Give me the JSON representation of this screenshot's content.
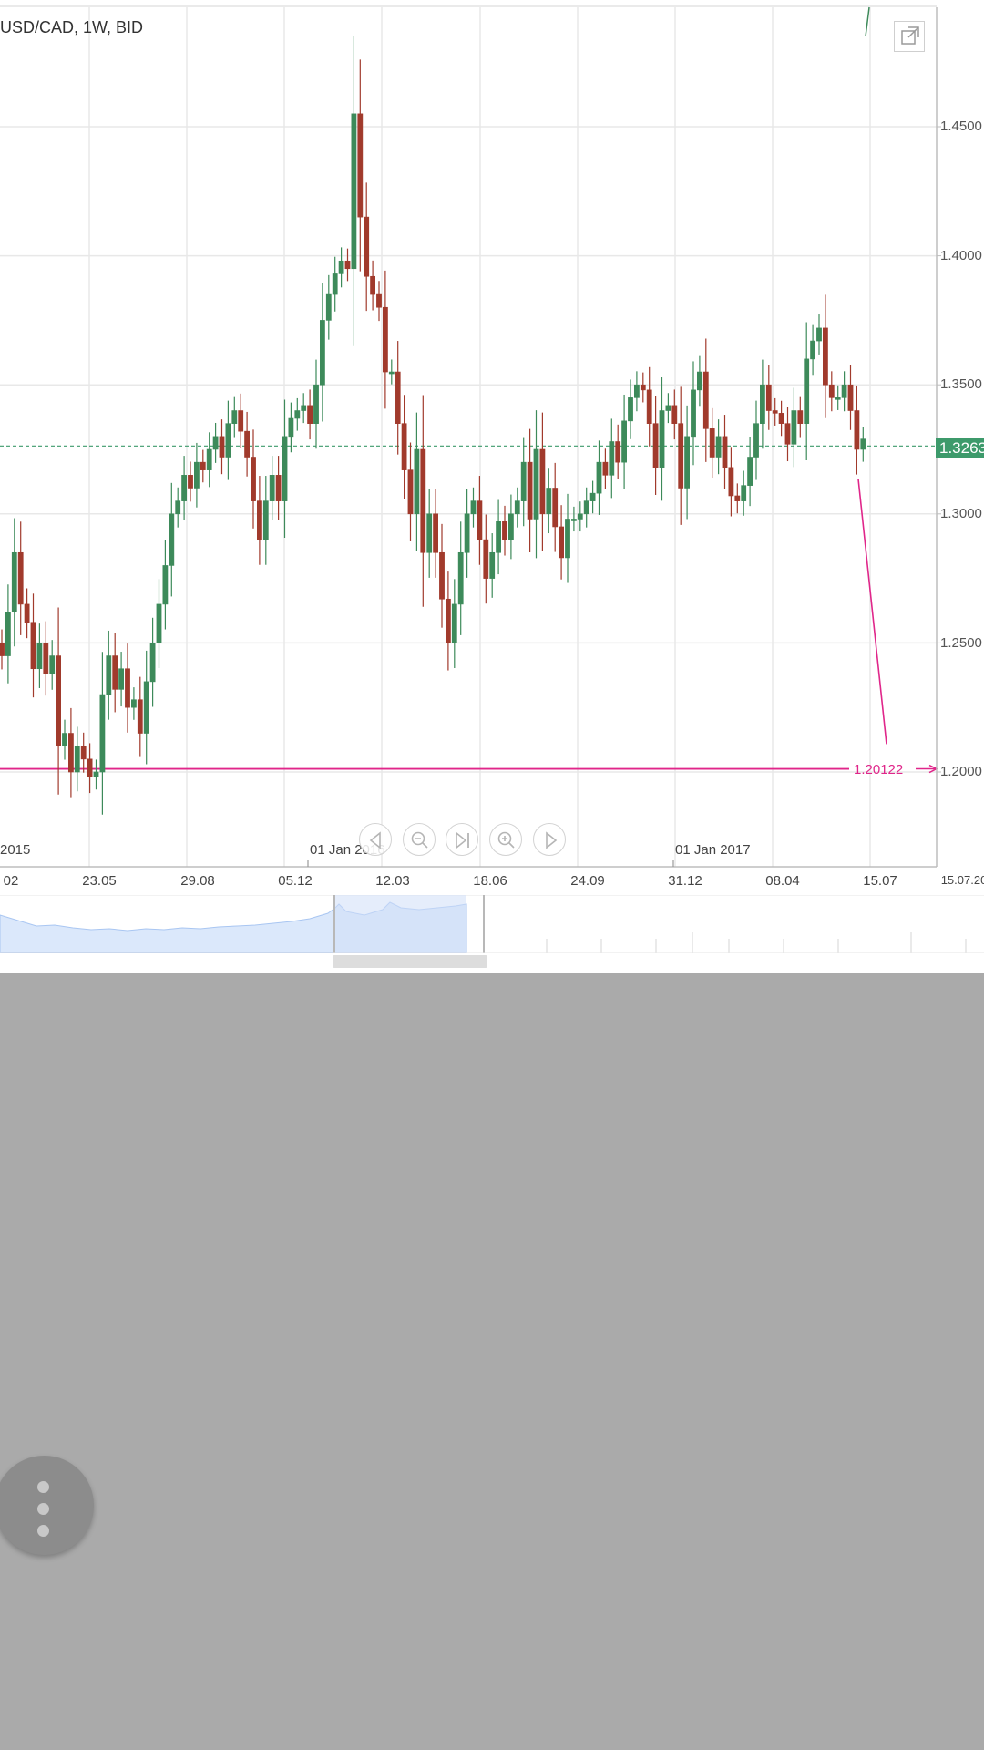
{
  "chart_title": "USD/CAD, 1W, BID",
  "current_price": "1.3263",
  "target_label": "1.20122",
  "y_axis_labels": [
    "1.4500",
    "1.4000",
    "1.3500",
    "1.3000",
    "1.2500",
    "1.2000"
  ],
  "x_axis_labels": [
    "02",
    "23.05",
    "29.08",
    "05.12",
    "12.03",
    "18.06",
    "24.09",
    "31.12",
    "08.04",
    "15.07",
    "15.07.20"
  ],
  "x_major_labels": [
    "2015",
    "01 Jan 2016",
    "01 Jan 2017"
  ],
  "nav_buttons": [
    {
      "name": "scroll-left-button",
      "icon": "triangle-left-icon"
    },
    {
      "name": "zoom-out-button",
      "icon": "zoom-out-icon"
    },
    {
      "name": "go-to-latest-button",
      "icon": "skip-to-end-icon"
    },
    {
      "name": "zoom-in-button",
      "icon": "zoom-in-icon"
    },
    {
      "name": "scroll-right-button",
      "icon": "triangle-right-icon"
    }
  ],
  "colors": {
    "bull": "#3d8a5a",
    "bear": "#a13a2c",
    "current_price": "#3d9a6b",
    "target_line": "#e0268a",
    "grid": "#e8e8e8",
    "background": "#aaaaaa"
  },
  "chart_data": {
    "type": "candlestick",
    "title": "USD/CAD, 1W, BID",
    "ylim": [
      1.17,
      1.49
    ],
    "y_ticks": [
      1.45,
      1.4,
      1.35,
      1.3,
      1.25,
      1.2
    ],
    "x_tick_labels": [
      "02",
      "23.05",
      "29.08",
      "05.12",
      "12.03",
      "18.06",
      "24.09",
      "31.12",
      "08.04",
      "15.07"
    ],
    "current_price": 1.3263,
    "target_level": 1.20122,
    "candles_close": [
      1.245,
      1.262,
      1.285,
      1.265,
      1.258,
      1.24,
      1.25,
      1.238,
      1.245,
      1.21,
      1.215,
      1.2,
      1.21,
      1.205,
      1.198,
      1.2,
      1.23,
      1.245,
      1.232,
      1.24,
      1.225,
      1.228,
      1.215,
      1.235,
      1.25,
      1.265,
      1.28,
      1.3,
      1.305,
      1.315,
      1.31,
      1.32,
      1.317,
      1.325,
      1.33,
      1.322,
      1.335,
      1.34,
      1.332,
      1.322,
      1.305,
      1.29,
      1.305,
      1.315,
      1.305,
      1.33,
      1.337,
      1.34,
      1.342,
      1.335,
      1.35,
      1.375,
      1.385,
      1.393,
      1.398,
      1.395,
      1.455,
      1.415,
      1.392,
      1.385,
      1.38,
      1.355,
      1.355,
      1.335,
      1.317,
      1.3,
      1.325,
      1.285,
      1.3,
      1.285,
      1.267,
      1.25,
      1.265,
      1.285,
      1.3,
      1.305,
      1.29,
      1.275,
      1.285,
      1.297,
      1.29,
      1.3,
      1.305,
      1.32,
      1.298,
      1.325,
      1.3,
      1.31,
      1.295,
      1.283,
      1.298,
      1.298,
      1.3,
      1.305,
      1.308,
      1.32,
      1.315,
      1.328,
      1.32,
      1.336,
      1.345,
      1.35,
      1.348,
      1.335,
      1.318,
      1.34,
      1.342,
      1.335,
      1.31,
      1.33,
      1.348,
      1.355,
      1.333,
      1.322,
      1.33,
      1.318,
      1.307,
      1.305,
      1.311,
      1.322,
      1.335,
      1.35,
      1.34,
      1.339,
      1.335,
      1.327,
      1.34,
      1.335,
      1.36,
      1.367,
      1.372,
      1.35,
      1.345,
      1.345,
      1.35,
      1.34,
      1.325,
      1.329
    ]
  }
}
